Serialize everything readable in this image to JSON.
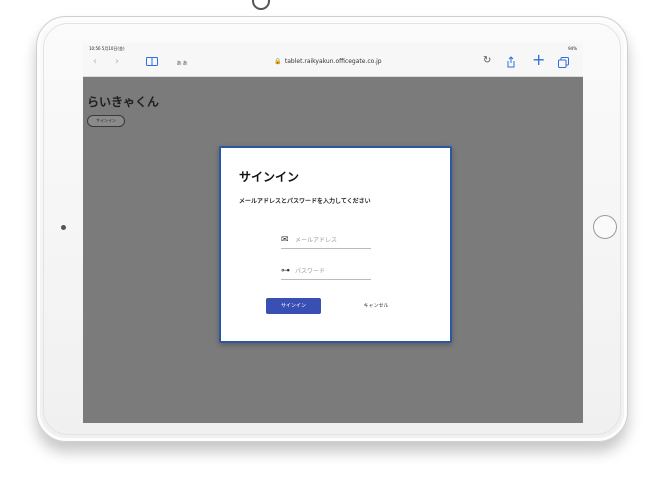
{
  "status_bar": {
    "time": "10:56 5月10日(金)",
    "battery": "94%"
  },
  "browser": {
    "back_icon": "chevron-left-icon",
    "forward_icon": "chevron-right-icon",
    "reader_label": "ぁぁ",
    "url": "tablet.raikyakun.officegate.co.jp",
    "lock_icon": "🔒",
    "reload_glyph": "↻",
    "plus_glyph": "+",
    "accent_color": "#2f6fe0"
  },
  "page": {
    "app_title": "らいきゃくん",
    "pill_label": "サインイン",
    "overlay_color": "#7b7b7b"
  },
  "dialog": {
    "title": "サインイン",
    "description": "メールアドレスとパスワードを入力してください",
    "email": {
      "icon_glyph": "✉",
      "placeholder": "メールアドレス",
      "value": ""
    },
    "password": {
      "icon_glyph": "⊶",
      "placeholder": "パスワード",
      "value": ""
    },
    "signin_label": "サインイン",
    "cancel_label": "キャンセル",
    "border_color": "#2a56a8",
    "button_color": "#3a4fb3"
  }
}
